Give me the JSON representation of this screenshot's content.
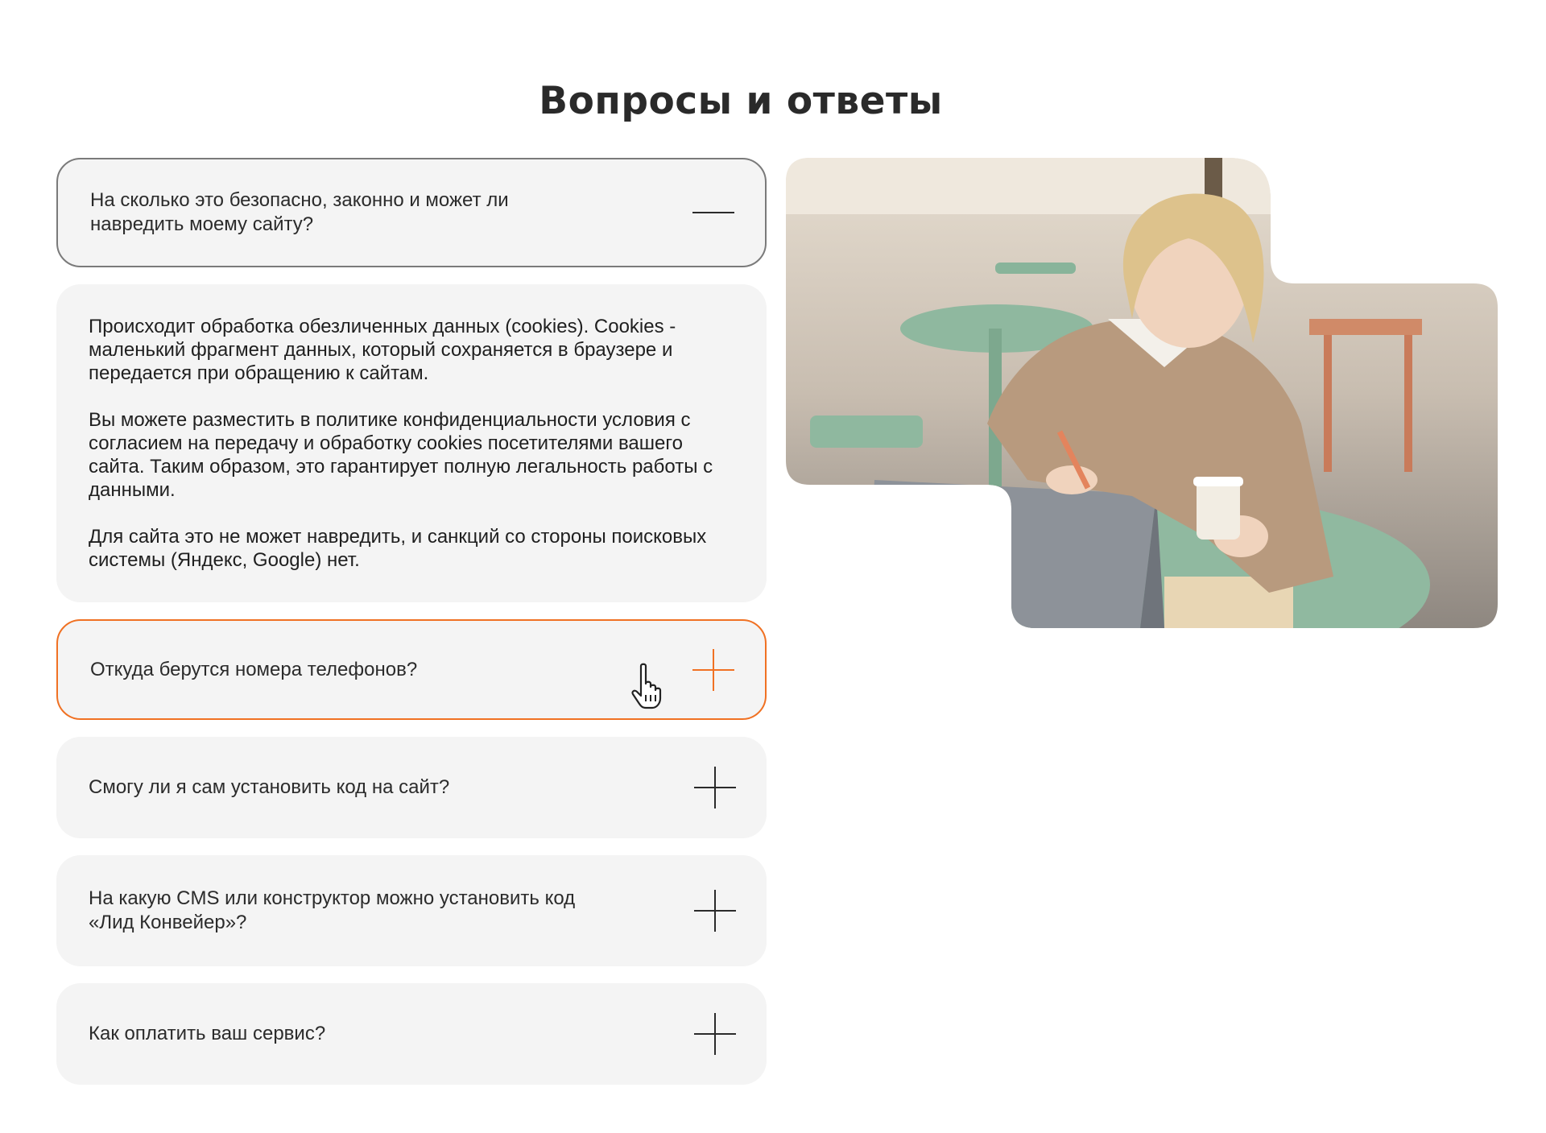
{
  "page": {
    "title": "Вопросы и ответы"
  },
  "faq": {
    "items": [
      {
        "question": "На сколько это безопасно, законно и может ли навредить моему сайту?",
        "state": "expanded",
        "icon": "minus-icon",
        "answer": [
          "Происходит обработка обезличенных данных (cookies). Cookies - маленький фрагмент данных, который сохраняется в браузере и передается при обращению к сайтам.",
          "Вы можете разместить в политике конфиденциальности условия с согласием на передачу и обработку cookies посетителями вашего сайта. Таким образом, это гарантирует полную легальность работы с данными.",
          "Для сайта это не может навредить, и санкций со стороны поисковых системы (Яндекс, Google) нет."
        ]
      },
      {
        "question": "Откуда берутся номера телефонов?",
        "state": "hover",
        "icon": "plus-icon"
      },
      {
        "question": "Смогу ли я сам установить код на сайт?",
        "state": "collapsed",
        "icon": "plus-icon"
      },
      {
        "question": "На какую CMS или конструктор можно установить код «Лид Конвейер»?",
        "state": "collapsed",
        "icon": "plus-icon"
      },
      {
        "question": "Как оплатить ваш сервис?",
        "state": "collapsed",
        "icon": "plus-icon"
      }
    ]
  },
  "colors": {
    "accent": "#f07123",
    "card_bg": "#f4f4f4",
    "active_border": "#7a7a7a",
    "text": "#2b2b2b"
  }
}
